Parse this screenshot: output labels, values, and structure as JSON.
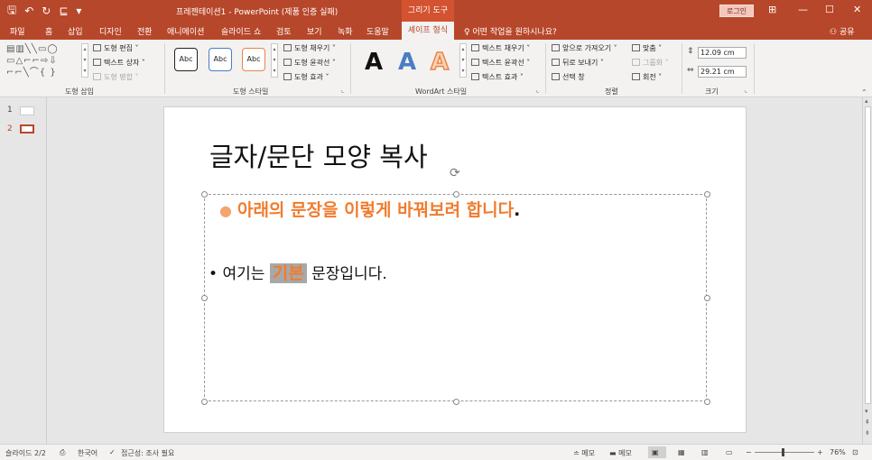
{
  "title_bar": {
    "qat": [
      "🖫",
      "↶",
      "↻",
      "⊑",
      "▾"
    ],
    "document_title": "프레젠테이션1  -  PowerPoint (제품 인증 실패)",
    "context_label": "그리기 도구",
    "login_label": "로그인",
    "window_buttons": [
      "⊞",
      "—",
      "☐",
      "✕"
    ]
  },
  "tabs": [
    {
      "label": "파일"
    },
    {
      "label": "홈"
    },
    {
      "label": "삽입"
    },
    {
      "label": "디자인"
    },
    {
      "label": "전환"
    },
    {
      "label": "애니메이션"
    },
    {
      "label": "슬라이드 쇼"
    },
    {
      "label": "검토"
    },
    {
      "label": "보기"
    },
    {
      "label": "녹화"
    },
    {
      "label": "도움말"
    },
    {
      "label": "셰이프 형식"
    }
  ],
  "tell_me": "어떤 작업을 원하시나요?",
  "share": "공유",
  "ribbon": {
    "insert_shapes": {
      "gallery": "▤▥╲╲▭◯\n▭△⌐⌐⇨⇩\n⌐⌐╲⌒{ }",
      "edit_shape": "도형 편집 ˅",
      "text_box": "텍스트 상자 ˅",
      "merge_shapes": "도형 병합 ˅",
      "label": "도형 삽입"
    },
    "shape_styles": {
      "presets": [
        "Abc",
        "Abc",
        "Abc"
      ],
      "fill": "도형 채우기 ˅",
      "outline": "도형 윤곽선 ˅",
      "effects": "도형 효과 ˅",
      "label": "도형 스타일"
    },
    "wordart": {
      "letters": [
        "A",
        "A",
        "A"
      ],
      "text_fill": "텍스트 채우기 ˅",
      "text_outline": "텍스트 윤곽선 ˅",
      "text_effects": "텍스트 효과 ˅",
      "label": "WordArt 스타일"
    },
    "arrange": {
      "bring_forward": "앞으로 가져오기 ˅",
      "send_backward": "뒤로 보내기 ˅",
      "selection_pane": "선택 창",
      "align": "맞춤 ˅",
      "group": "그룹화 ˅",
      "rotate": "회전 ˅",
      "label": "정렬"
    },
    "size": {
      "height": "12.09 cm",
      "width": "29.21 cm",
      "label": "크기"
    }
  },
  "thumbnails": [
    {
      "number": "1"
    },
    {
      "number": "2"
    }
  ],
  "slide": {
    "title": "글자/문단 모양 복사",
    "bullet1_text": "아래의 문장을 이렇게 바꿔보려 합니다",
    "bullet1_end": ".",
    "bullet2_before": "여기는 ",
    "bullet2_highlight": "기본",
    "bullet2_after": " 문장입니다."
  },
  "status_bar": {
    "slide_indicator": "슬라이드 2/2",
    "language": "한국어",
    "accessibility": "접근성: 조사 필요",
    "notes": "≐ 메모",
    "comments": "메모",
    "zoom_minus": "−",
    "zoom_plus": "+",
    "zoom": "76%"
  },
  "colors": {
    "brand": "#b7472a",
    "accent_orange": "#f07c2e",
    "highlight_gray": "#a8a8a8"
  }
}
